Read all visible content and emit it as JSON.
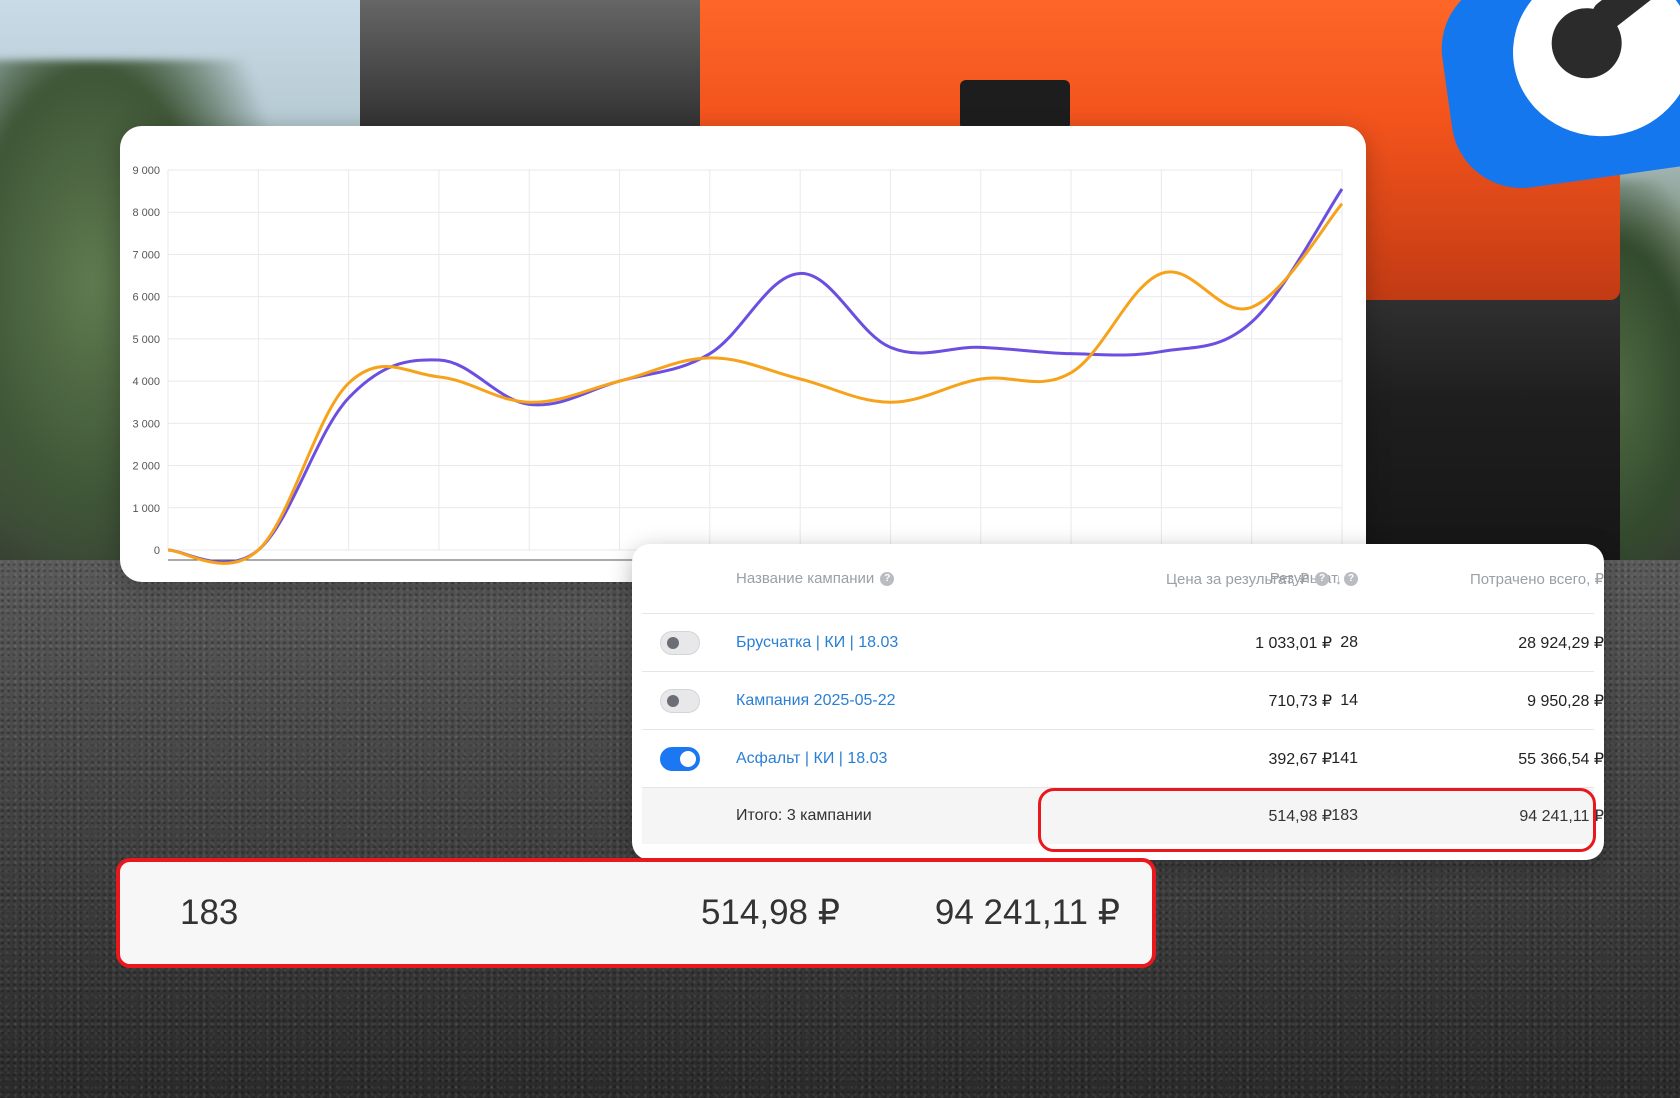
{
  "chart_data": {
    "type": "line",
    "x": [
      0,
      1,
      2,
      3,
      4,
      5,
      6,
      7,
      8,
      9,
      10,
      11,
      12,
      13
    ],
    "ylim": [
      0,
      9000
    ],
    "yticks": [
      "0",
      "1 000",
      "2 000",
      "3 000",
      "4 000",
      "5 000",
      "6 000",
      "7 000",
      "8 000",
      "9 000"
    ],
    "grid": true,
    "series": [
      {
        "color": "#6c4fe0",
        "values": [
          0,
          0,
          3600,
          4500,
          3450,
          4000,
          4650,
          6550,
          4800,
          4800,
          4650,
          4700,
          5400,
          8550
        ]
      },
      {
        "color": "#f7a21b",
        "values": [
          0,
          0,
          3950,
          4100,
          3500,
          4000,
          4550,
          4050,
          3500,
          4050,
          4200,
          6550,
          5750,
          8200
        ]
      }
    ]
  },
  "table": {
    "headers": {
      "name": "Название кампании",
      "result": "Результат",
      "price": "Цена за результат, ₽",
      "spent": "Потрачено всего, ₽"
    },
    "rows": [
      {
        "toggle_on": false,
        "name": "Брусчатка | КИ | 18.03",
        "result": "28",
        "price": "1 033,01 ₽",
        "spent": "28 924,29 ₽"
      },
      {
        "toggle_on": false,
        "name": "Кампания 2025-05-22",
        "result": "14",
        "price": "710,73 ₽",
        "spent": "9 950,28 ₽"
      },
      {
        "toggle_on": true,
        "name": "Асфальт | КИ | 18.03",
        "result": "141",
        "price": "392,67 ₽",
        "spent": "55 366,54 ₽"
      }
    ],
    "total": {
      "label": "Итого: 3 кампании",
      "result": "183",
      "price": "514,98 ₽",
      "spent": "94 241,11 ₽"
    }
  },
  "zoom_totals": {
    "result": "183",
    "price": "514,98 ₽",
    "spent": "94 241,11 ₽"
  },
  "icons": {
    "help": "?",
    "sort": "↓"
  },
  "colors": {
    "link": "#2a7fd4",
    "highlight": "#e8181d",
    "toggle_on": "#1b78f2",
    "brand": "#1577ee"
  }
}
